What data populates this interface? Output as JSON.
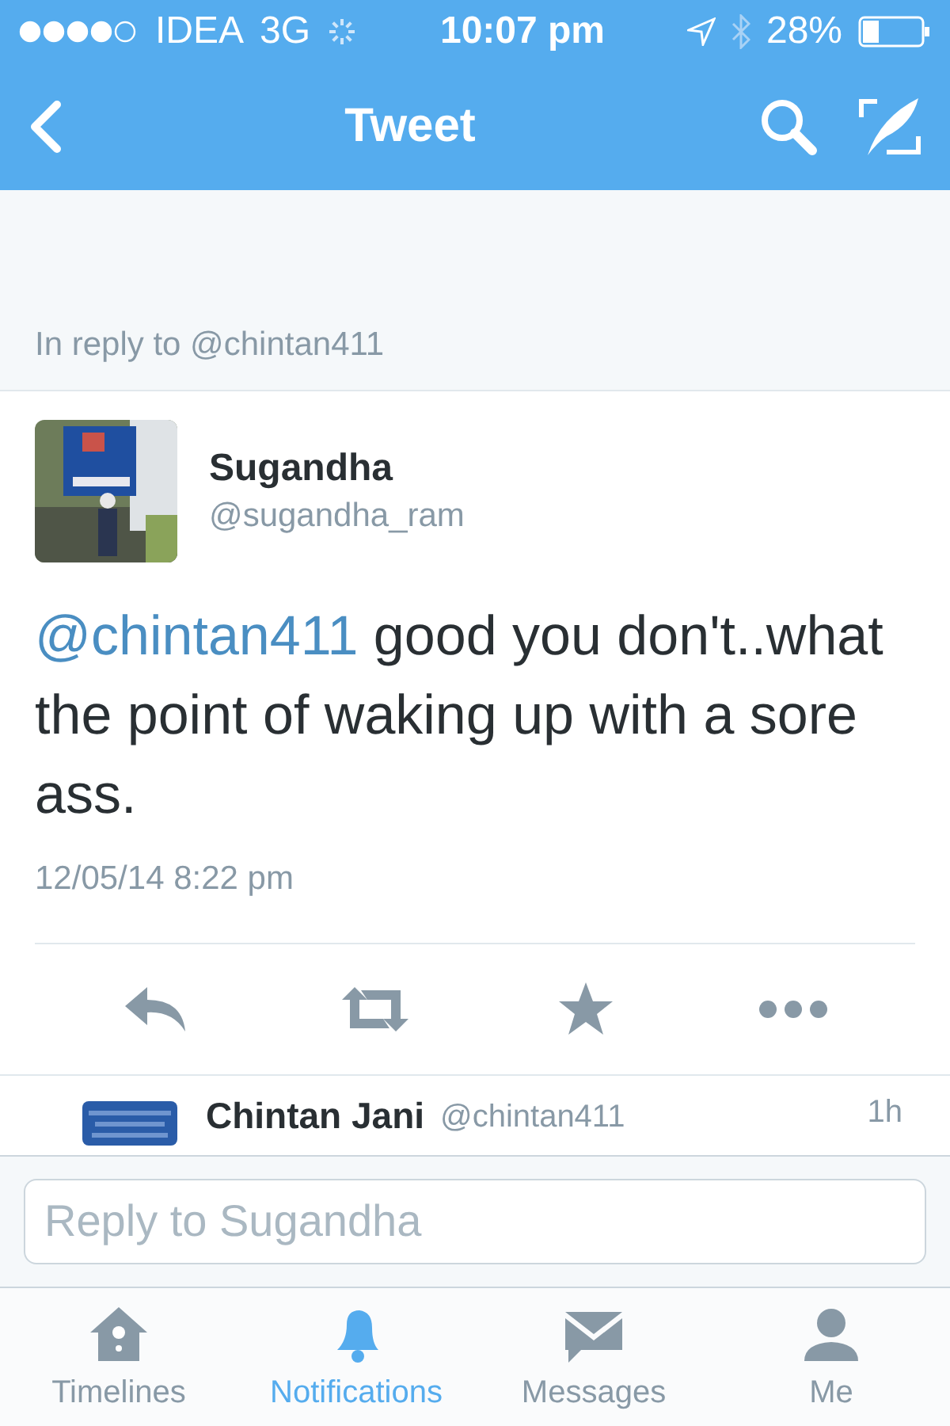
{
  "status_bar": {
    "carrier": "IDEA",
    "network": "3G",
    "time": "10:07 pm",
    "battery": "28%"
  },
  "nav_bar": {
    "title": "Tweet"
  },
  "reply_context": "In reply to @chintan411",
  "tweet": {
    "name": "Sugandha",
    "handle": "@sugandha_ram",
    "mention": "@chintan411",
    "text": " good you don't..what the point of waking up with a sore ass.",
    "date": "12/05/14 8:22 pm"
  },
  "actions": [
    {
      "kind": "reply"
    },
    {
      "kind": "retweet"
    },
    {
      "kind": "favorite"
    },
    {
      "kind": "more"
    }
  ],
  "next_tweet": {
    "name": "Chintan Jani",
    "handle": "@chintan411",
    "time": "1h"
  },
  "reply_field": {
    "placeholder": "Reply to Sugandha"
  },
  "tabs": [
    {
      "label": "Timelines",
      "kind": "home",
      "selected": false
    },
    {
      "label": "Notifications",
      "kind": "bell",
      "selected": true
    },
    {
      "label": "Messages",
      "kind": "mail",
      "selected": false
    },
    {
      "label": "Me",
      "kind": "person",
      "selected": false
    }
  ]
}
